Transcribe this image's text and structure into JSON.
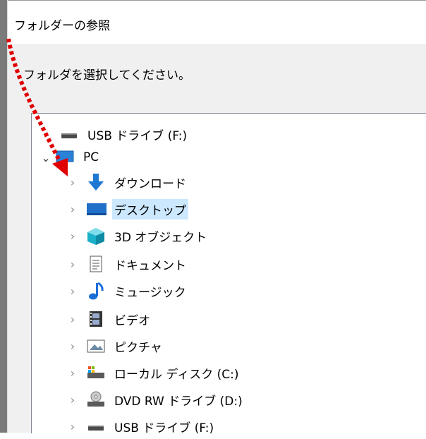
{
  "window": {
    "title": "フォルダーの参照"
  },
  "dialog": {
    "instruction": "フォルダを選択してください。"
  },
  "tree": {
    "items": [
      {
        "label": "USB ドライブ (F:)",
        "icon": "usb-drive-icon",
        "level": 1,
        "chevron": "right",
        "selected": false
      },
      {
        "label": "PC",
        "icon": "pc-monitor-icon",
        "level": 1,
        "chevron": "down",
        "selected": false
      },
      {
        "label": "ダウンロード",
        "icon": "download-arrow-icon",
        "level": 2,
        "chevron": "right",
        "selected": false
      },
      {
        "label": "デスクトップ",
        "icon": "desktop-icon",
        "level": 2,
        "chevron": "right",
        "selected": true
      },
      {
        "label": "3D オブジェクト",
        "icon": "cube-3d-icon",
        "level": 2,
        "chevron": "right",
        "selected": false
      },
      {
        "label": "ドキュメント",
        "icon": "document-icon",
        "level": 2,
        "chevron": "right",
        "selected": false
      },
      {
        "label": "ミュージック",
        "icon": "music-note-icon",
        "level": 2,
        "chevron": "right",
        "selected": false
      },
      {
        "label": "ビデオ",
        "icon": "video-film-icon",
        "level": 2,
        "chevron": "right",
        "selected": false
      },
      {
        "label": "ピクチャ",
        "icon": "picture-icon",
        "level": 2,
        "chevron": "right",
        "selected": false
      },
      {
        "label": "ローカル ディスク (C:)",
        "icon": "local-disk-icon",
        "level": 2,
        "chevron": "right",
        "selected": false
      },
      {
        "label": "DVD RW ドライブ (D:)",
        "icon": "dvd-drive-icon",
        "level": 2,
        "chevron": "right",
        "selected": false
      },
      {
        "label": "USB ドライブ (F:)",
        "icon": "usb-drive-icon",
        "level": 2,
        "chevron": "right",
        "selected": false
      }
    ]
  },
  "annotation": {
    "arrow_color": "#e00000",
    "style": "dotted"
  },
  "colors": {
    "selection": "#cce8ff",
    "download_blue": "#1e78d2",
    "music_blue": "#1a6ed8",
    "cube_teal": "#1ab0c8"
  }
}
